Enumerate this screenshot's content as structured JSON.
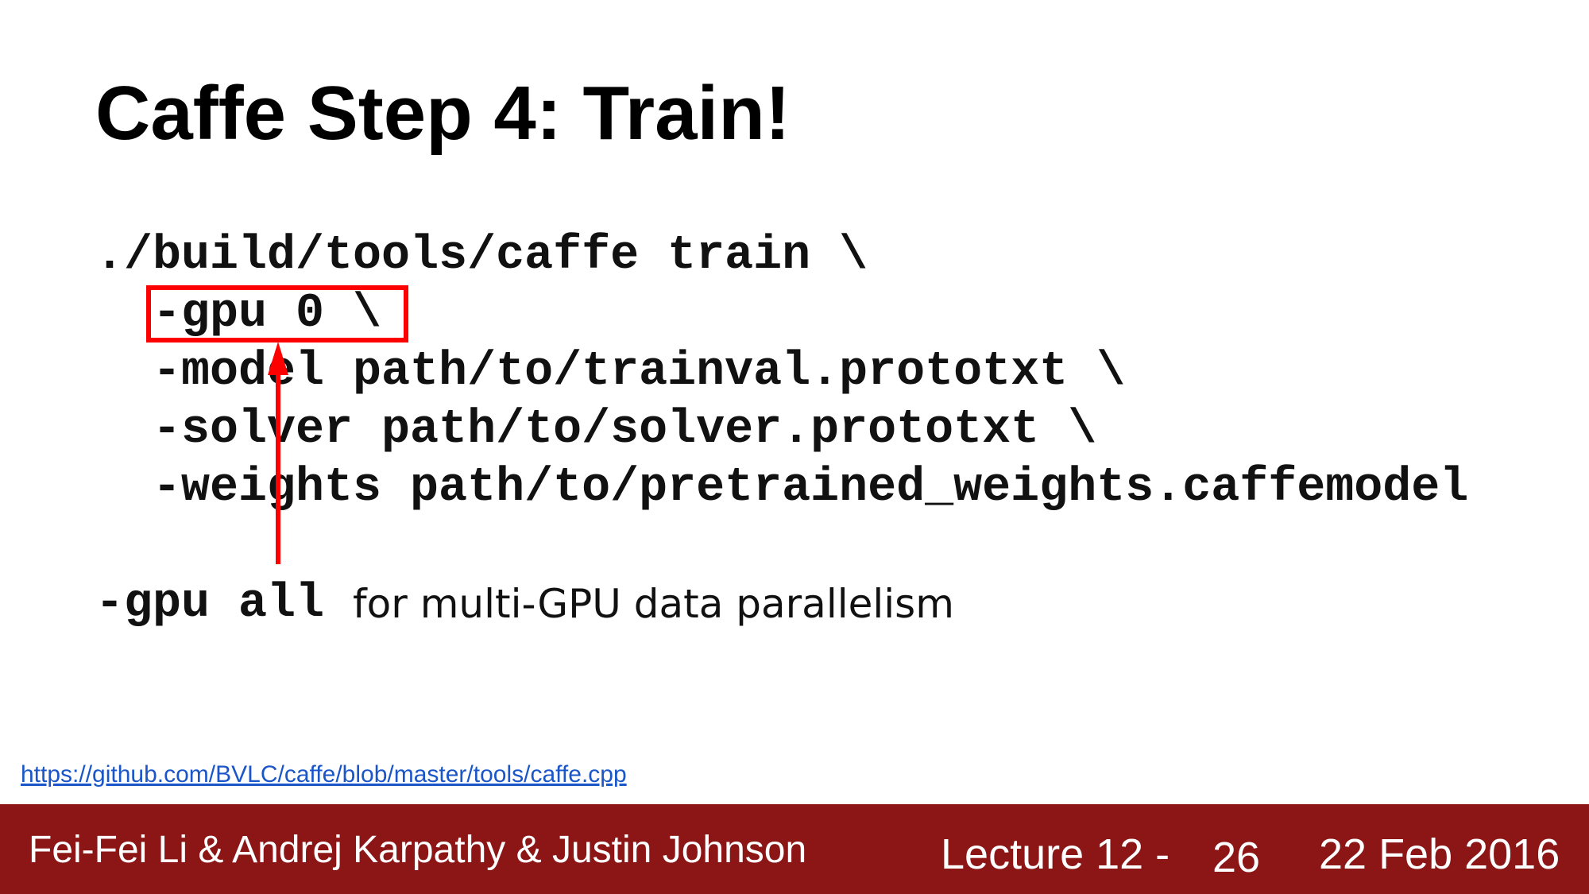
{
  "slide": {
    "title": "Caffe Step 4: Train!"
  },
  "command": {
    "lines": [
      "./build/tools/caffe train \\",
      "-gpu 0 \\",
      "-model path/to/trainval.prototxt \\",
      "-solver path/to/solver.prototxt \\",
      "-weights path/to/pretrained_weights.caffemodel"
    ],
    "highlight_color": "#ff0000"
  },
  "note": {
    "code": "-gpu all",
    "text": "for multi-GPU data parallelism"
  },
  "source_link": "https://github.com/BVLC/caffe/blob/master/tools/caffe.cpp",
  "footer": {
    "authors": "Fei-Fei Li & Andrej Karpathy & Justin Johnson",
    "lecture": "Lecture 12 -",
    "page": "26",
    "date": "22 Feb 2016",
    "background_color": "#8c1515"
  }
}
